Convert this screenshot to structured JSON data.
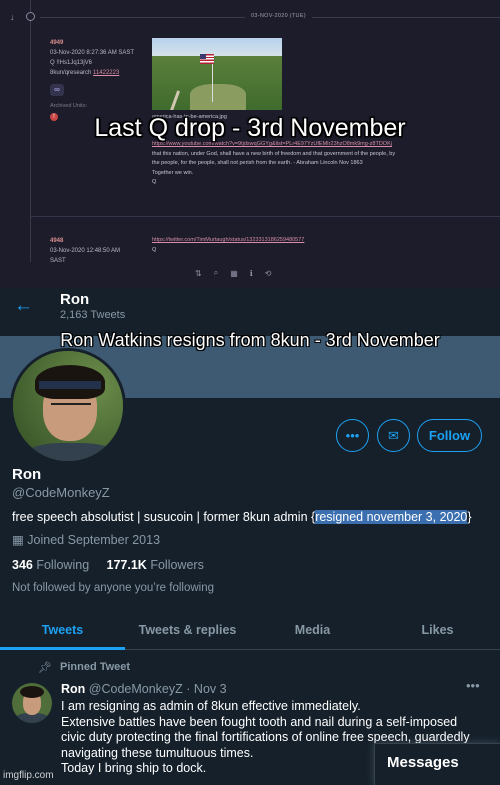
{
  "top_panel": {
    "date_label": "03-NOV-2020 (TUE)",
    "post1": {
      "number": "4949",
      "timestamp": "03-Nov-2020 8:27:36 AM SAST",
      "trip": "Q  !!Hs1Jq13jV6",
      "board": "8kun/",
      "board_link": "qresearch",
      "thread": "11422223",
      "archived_label": "Archived Units:",
      "image_filename": "america-has-to-be-america.jpg",
      "link": "https://www.youtube.com/watch?v=9tjdswqGGYg&list=PLr4E97YzUfEMIr23hzO8mk9mg-z8TDOKj",
      "lines": [
        "that this nation, under God, shall have a new birth of freedom and that government of the people, by",
        "the people, for the people, shall not perish from the earth. - Abraham Lincoln Nov 1863",
        "Together we win.",
        "Q"
      ]
    },
    "post2": {
      "number": "4948",
      "timestamp": "03-Nov-2020 12:48:50 AM",
      "timestamp2": "SAST",
      "link": "https://twitter.com/TimMurtaugh/status/1323313186259480577",
      "sig": "Q"
    },
    "overlay_caption": "Last Q drop - 3rd November",
    "toolbar_icons": [
      "⇅",
      "⌕",
      "▦",
      "ℹ",
      "⟲"
    ]
  },
  "profile": {
    "header_name": "Ron",
    "tweet_count": "2,163 Tweets",
    "overlay_caption": "Ron Watkins resigns from 8kun - 3rd November",
    "more_button": "•••",
    "message_button": "✉",
    "follow_label": "Follow",
    "name": "Ron",
    "handle": "@CodeMonkeyZ",
    "bio_prefix": "free speech absolutist | susucoin | former 8kun admin {",
    "bio_highlight": "resigned november 3, 2020",
    "bio_suffix": "}",
    "joined_icon": "▦",
    "joined": "Joined September 2013",
    "following_count": "346",
    "following_label": "Following",
    "followers_count": "177.1K",
    "followers_label": "Followers",
    "not_followed": "Not followed by anyone you’re following"
  },
  "tabs": [
    {
      "label": "Tweets",
      "active": true
    },
    {
      "label": "Tweets & replies",
      "active": false
    },
    {
      "label": "Media",
      "active": false
    },
    {
      "label": "Likes",
      "active": false
    }
  ],
  "pinned_tweet": {
    "pin_label": "Pinned Tweet",
    "name": "Ron",
    "handle": "@CodeMonkeyZ",
    "sep": "·",
    "date": "Nov 3",
    "more": "•••",
    "lines": [
      "I am resigning as admin of 8kun effective immediately.",
      "Extensive battles have been fought tooth and nail during a self-imposed",
      "civic duty protecting the final fortifications of online free speech, guardedly",
      "navigating these tumultuous times.",
      "Today I bring ship to dock."
    ]
  },
  "messages_label": "Messages",
  "watermark": "imgflip.com",
  "colors": {
    "accent": "#1da1f2",
    "background": "#15202b",
    "q_background": "#1c1c2a"
  }
}
